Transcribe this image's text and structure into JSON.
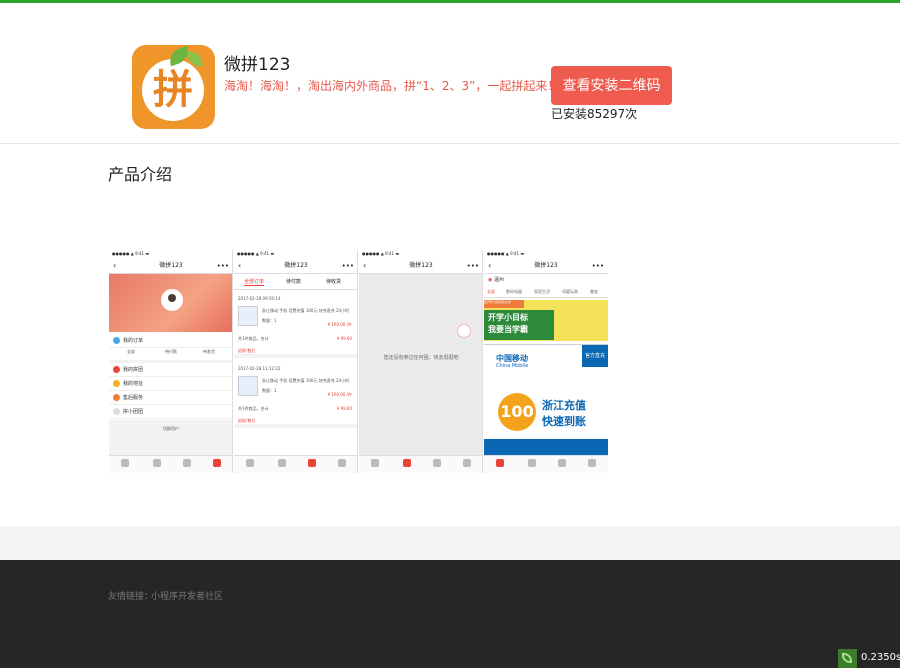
{
  "app": {
    "name": "微拼123",
    "icon_glyph": "拼",
    "description": "海淘！海淘！，淘出海内外商品，拼“1、2、3”，一起拼起来！",
    "install_button": "查看安装二维码",
    "install_count": "已安装85297次"
  },
  "section": {
    "title": "产品介绍"
  },
  "screenshots": {
    "phone1": {
      "title": "微拼123",
      "rows": [
        "我的订单",
        "我的拼团",
        "我的地址",
        "售后服务",
        "拼小团团"
      ],
      "sub_tabs": [
        "全部",
        "待付款",
        "待发货"
      ],
      "logout": "切换用户"
    },
    "phone2": {
      "title": "微拼123",
      "tabs": [
        "全部订单",
        "待付款",
        "待收货"
      ],
      "orders": [
        {
          "date": "2017-02-28 09:50:14",
          "desc": "浙江移动 手机 话费充值 100元 快充直充 24小时",
          "qty": "数量：1",
          "price": "¥ 100.00 /件",
          "shop": "共1件商品，合计",
          "total": "¥ 99.60",
          "link": "退款/售后"
        },
        {
          "date": "2017-02-28 11:12:22",
          "desc": "浙江移动 手机 话费充值 100元 快充直充 24小时",
          "qty": "数量：1",
          "price": "¥ 100.00 /件",
          "shop": "共1件商品，合计",
          "total": "¥ 99.60",
          "link": "退款/售后"
        }
      ]
    },
    "phone3": {
      "title": "微拼123",
      "empty_text": "您还没有参过任何团，快去逛逛吧"
    },
    "phone4": {
      "title": "微拼123",
      "location": "温州",
      "cats": [
        "全部",
        "数码电器",
        "家居生活",
        "母婴玩具",
        "美妆"
      ],
      "ad1_tag": "拉开学习目标新主张",
      "ad1_line1": "开学小目标",
      "ad1_line2": "我要当学霸",
      "ad2_logo": "中国移动",
      "ad2_logo_en": "China Mobile",
      "ad2_ribbon": "官方直充",
      "ad2_amount": "100",
      "ad2_line1": "浙江充值",
      "ad2_line2": "快速到账"
    }
  },
  "footer": {
    "friend_label": "友情链接：",
    "friend_link": "小程序开发者社区"
  },
  "timer": {
    "value": "0.2350s"
  },
  "colors": {
    "accent_green": "#2ca32c",
    "button_red": "#f05b4f",
    "footer_bg": "#262626"
  }
}
